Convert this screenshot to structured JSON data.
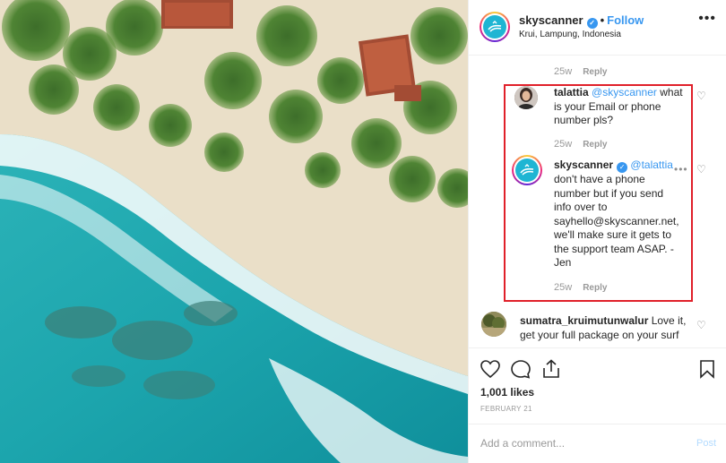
{
  "post": {
    "account": "skyscanner",
    "follow_label": "Follow",
    "separator": "•",
    "location": "Krui, Lampung, Indonesia",
    "more": "•••"
  },
  "comments": {
    "top_meta": {
      "age": "25w",
      "reply": "Reply"
    },
    "items": [
      {
        "username": "talattia",
        "mention": "@skyscanner",
        "text_line1": " what",
        "text_rest": [
          "is your Email or phone",
          "number pls?"
        ],
        "age": "25w",
        "reply": "Reply"
      },
      {
        "username": "skyscanner",
        "mention": "@talattia",
        "text_line1": "",
        "text_rest": [
          "don't have a phone",
          "number but if you send",
          "info over to",
          "sayhello@skyscanner.net,",
          "we'll make sure it gets to",
          "the support team ASAP. -",
          "Jen"
        ],
        "age": "25w",
        "reply": "Reply"
      },
      {
        "username": "sumatra_kruimutunwalur",
        "text_line1": " Love it,",
        "text_rest": [
          "get your full package on your surf"
        ]
      }
    ],
    "heart_icon": "heart-outline-icon"
  },
  "actions": {
    "likes": "1,001 likes",
    "date": "FEBRUARY 21"
  },
  "add_comment": {
    "placeholder": "Add a comment...",
    "post_label": "Post"
  },
  "colors": {
    "accent": "#3897f0",
    "highlight_box": "#e0202a",
    "skyscanner_avatar": "#1fb5d3"
  }
}
